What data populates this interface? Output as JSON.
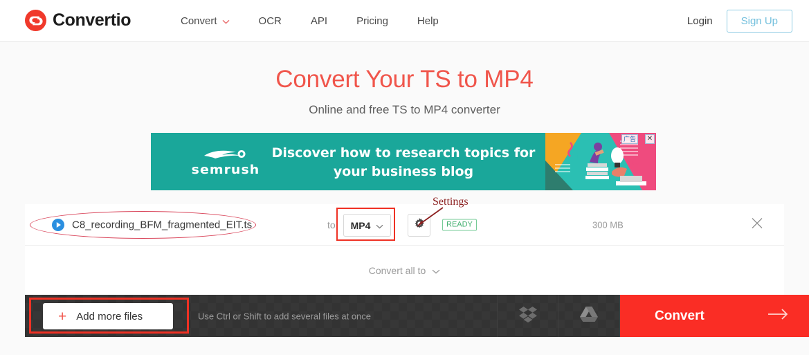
{
  "brand": {
    "name": "Convertio",
    "logo_icon": "convertio-circle-arrows-icon",
    "accent_red": "#f0392b"
  },
  "header": {
    "nav": [
      {
        "label": "Convert",
        "icon": "chevron-down-icon",
        "has_caret": true
      },
      {
        "label": "OCR",
        "has_caret": false
      },
      {
        "label": "API",
        "has_caret": false
      },
      {
        "label": "Pricing",
        "has_caret": false
      },
      {
        "label": "Help",
        "has_caret": false
      }
    ],
    "login_label": "Login",
    "signup_label": "Sign Up",
    "signup_border_color": "#8ecbe3"
  },
  "hero": {
    "title": "Convert Your TS to MP4",
    "subtitle": "Online and free TS to MP4 converter",
    "title_color": "#f0554b"
  },
  "ad": {
    "advertiser": "semrush",
    "advertiser_icon": "semrush-flame-icon",
    "headline_line1": "Discover how to research topics for",
    "headline_line2": "your business blog",
    "bg_color": "#1aa79a",
    "ad_badge_label": "广告",
    "close_icon": "close-icon",
    "art_icon": "woman-reading-lightbulb-illustration"
  },
  "file_row": {
    "play_icon": "play-circle-icon",
    "filename": "C8_recording_BFM_fragmented_EIT.ts",
    "to_label": "to",
    "target_format": "MP4",
    "format_caret_icon": "chevron-down-icon",
    "settings_icon": "gear-icon",
    "status": "READY",
    "status_color": "#3fae6c",
    "size": "300 MB",
    "remove_icon": "close-icon"
  },
  "convert_all": {
    "label": "Convert all to",
    "caret_icon": "chevron-down-icon"
  },
  "bottom_bar": {
    "add_more_label": "Add more files",
    "add_more_icon": "plus-icon",
    "hint": "Use Ctrl or Shift to add several files at once",
    "dropbox_icon": "dropbox-icon",
    "gdrive_icon": "google-drive-icon",
    "convert_label": "Convert",
    "convert_arrow_icon": "arrow-right-icon",
    "convert_color": "#fa2d25"
  },
  "annotations": {
    "settings_label": "Settings",
    "ellipse_color": "#d9455a",
    "box_color": "#ef3124",
    "label_color": "#8c1f1f"
  }
}
